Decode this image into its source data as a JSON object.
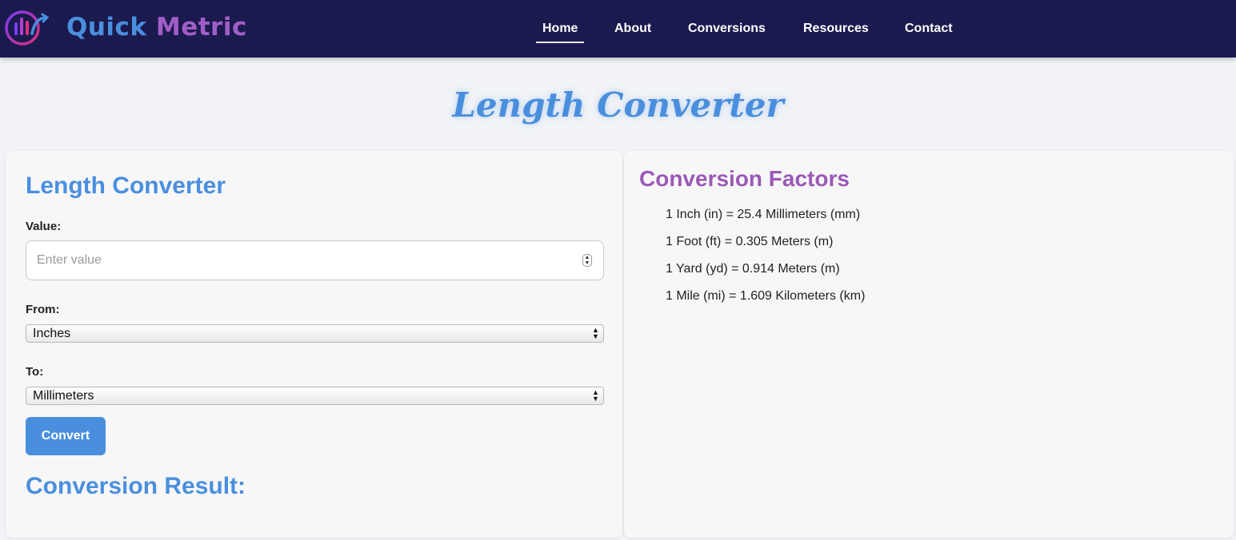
{
  "brand": {
    "name_part1": "Quick",
    "name_part2": "Metric",
    "icon": "bar-chart-logo-icon",
    "color_primary": "#4a8fde",
    "color_secondary": "#a25ec8"
  },
  "nav": {
    "items": [
      {
        "label": "Home",
        "active": true
      },
      {
        "label": "About",
        "active": false
      },
      {
        "label": "Conversions",
        "active": false
      },
      {
        "label": "Resources",
        "active": false
      },
      {
        "label": "Contact",
        "active": false
      }
    ],
    "background": "#1b1a4f"
  },
  "page": {
    "title": "Length Converter"
  },
  "converter": {
    "heading": "Length Converter",
    "value_label": "Value:",
    "value": "",
    "value_placeholder": "Enter value",
    "from_label": "From:",
    "from_selected": "Inches",
    "to_label": "To:",
    "to_selected": "Millimeters",
    "convert_label": "Convert",
    "result_heading": "Conversion Result:"
  },
  "factors": {
    "heading": "Conversion Factors",
    "items": [
      "1 Inch (in) = 25.4 Millimeters (mm)",
      "1 Foot (ft) = 0.305 Meters (m)",
      "1 Yard (yd) = 0.914 Meters (m)",
      "1 Mile (mi) = 1.609 Kilometers (km)"
    ]
  },
  "colors": {
    "accent_blue": "#4a8fde",
    "accent_purple": "#9b59b6"
  }
}
